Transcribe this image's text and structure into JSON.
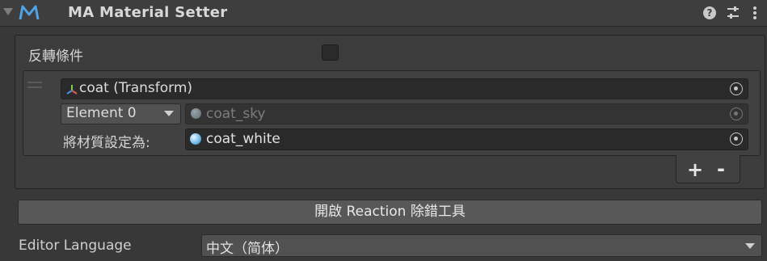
{
  "header": {
    "title": "MA Material Setter",
    "help_icon": "help-icon",
    "presets_icon": "presets-sliders-icon",
    "more_icon": "kebab-menu-icon",
    "help_glyph": "?"
  },
  "invert": {
    "label": "反轉條件",
    "checked": false
  },
  "list": {
    "object_field": {
      "value": "coat (Transform)",
      "icon": "transform-icon"
    },
    "element_dropdown": {
      "value": "Element 0"
    },
    "from_material": {
      "value": "coat_sky",
      "icon": "material-sphere-icon"
    },
    "set_label": "將材質設定為:",
    "to_material": {
      "value": "coat_white",
      "icon": "material-sphere-icon"
    }
  },
  "add_remove": {
    "add": "+",
    "remove": "-"
  },
  "debug_button": {
    "label": "開啟 Reaction 除錯工具"
  },
  "language": {
    "label": "Editor Language",
    "value": "中文（简体）"
  },
  "colors": {
    "background": "#383838",
    "field": "#2a2a2a",
    "accent": "#6cb7e8"
  }
}
